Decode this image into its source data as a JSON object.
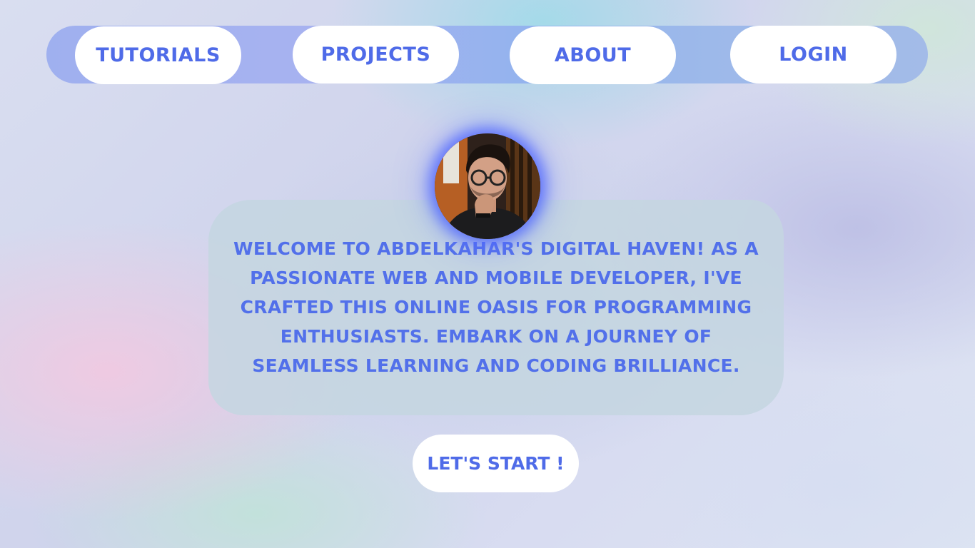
{
  "nav": {
    "items": [
      {
        "label": "TUTORIALS"
      },
      {
        "label": "PROJECTS"
      },
      {
        "label": "ABOUT"
      },
      {
        "label": "LOGIN"
      }
    ]
  },
  "profile": {
    "avatar": "profile-photo"
  },
  "hero": {
    "text": "WELCOME TO ABDELKAHAR'S DIGITAL HAVEN! AS A PASSIONATE WEB AND MOBILE DEVELOPER, I'VE CRAFTED THIS ONLINE OASIS FOR PROGRAMMING ENTHUSIASTS. EMBARK ON A JOURNEY OF SEAMLESS LEARNING AND CODING BRILLIANCE.",
    "cta_label": "LET'S START !"
  },
  "colors": {
    "accent": "#4f6be8",
    "nav_bar": "#9fb0ef",
    "card": "#c4d6e0",
    "button_bg": "#ffffff"
  }
}
